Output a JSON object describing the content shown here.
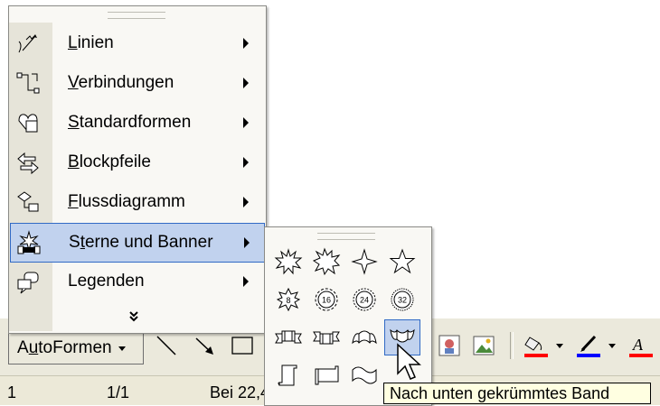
{
  "menu": {
    "items": [
      {
        "label_pre": "",
        "label_ul": "L",
        "label_post": "inien",
        "icon": "lines-icon"
      },
      {
        "label_pre": "",
        "label_ul": "V",
        "label_post": "erbindungen",
        "icon": "connectors-icon"
      },
      {
        "label_pre": "",
        "label_ul": "S",
        "label_post": "tandardformen",
        "icon": "basic-shapes-icon"
      },
      {
        "label_pre": "",
        "label_ul": "B",
        "label_post": "lockpfeile",
        "icon": "block-arrows-icon"
      },
      {
        "label_pre": "",
        "label_ul": "F",
        "label_post": "lussdiagramm",
        "icon": "flowchart-icon"
      },
      {
        "label_pre": "S",
        "label_ul": "t",
        "label_post": "erne und Banner",
        "icon": "stars-banners-icon"
      },
      {
        "label_pre": "Le",
        "label_ul": "g",
        "label_post": "enden",
        "icon": "callouts-icon"
      }
    ],
    "more": "»"
  },
  "toolbar": {
    "autoformen_pre": "A",
    "autoformen_ul": "u",
    "autoformen_post": "toFormen",
    "accent_fill": "#ff0000",
    "accent_line": "#0000ff"
  },
  "submenu": {
    "shapes": [
      {
        "name": "explosion-1-icon"
      },
      {
        "name": "explosion-2-icon"
      },
      {
        "name": "4-point-star-icon"
      },
      {
        "name": "5-point-star-icon"
      },
      {
        "name": "8-point-star-icon",
        "label": "8"
      },
      {
        "name": "16-point-star-icon",
        "label": "16"
      },
      {
        "name": "24-point-star-icon",
        "label": "24"
      },
      {
        "name": "32-point-star-icon",
        "label": "32"
      },
      {
        "name": "up-ribbon-icon"
      },
      {
        "name": "down-ribbon-icon"
      },
      {
        "name": "curved-up-ribbon-icon"
      },
      {
        "name": "curved-down-ribbon-icon"
      },
      {
        "name": "vertical-scroll-icon"
      },
      {
        "name": "horizontal-scroll-icon"
      },
      {
        "name": "wave-icon"
      },
      {
        "name": "double-wave-icon"
      }
    ]
  },
  "tooltip": "Nach unten gekrümmtes Band",
  "status": {
    "page": "1",
    "pages": "1/1",
    "position": "Bei 22,4"
  }
}
